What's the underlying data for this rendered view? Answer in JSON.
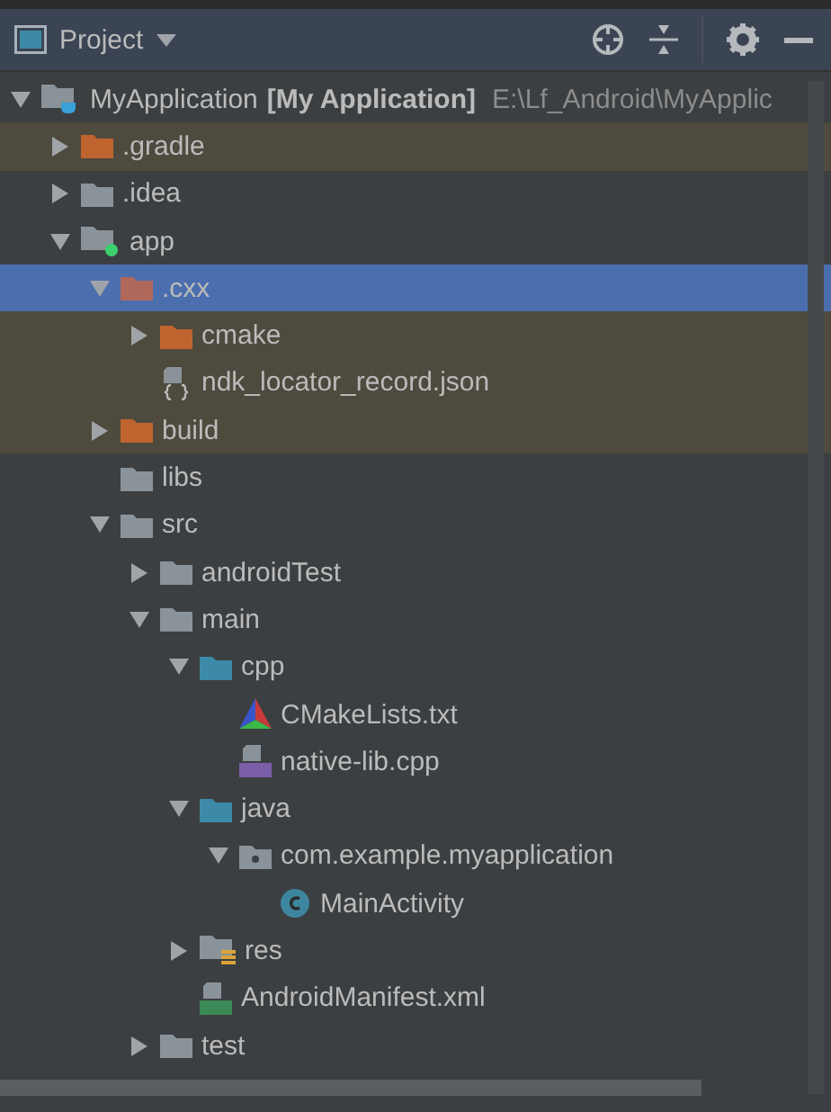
{
  "panel": {
    "title": "Project"
  },
  "tree": [
    {
      "kind": "module",
      "name": "MyApplication",
      "module": "[My Application]",
      "path": "E:\\Lf_Android\\MyApplic",
      "expanded": true,
      "selected": false,
      "excluded": false,
      "children": [
        {
          "kind": "folder",
          "color": "#c0642f",
          "name": ".gradle",
          "expanded": false,
          "selected": false,
          "excluded": true
        },
        {
          "kind": "folder",
          "color": "#8a9399",
          "name": ".idea",
          "expanded": false,
          "selected": false,
          "excluded": false
        },
        {
          "kind": "app-module",
          "name": "app",
          "expanded": true,
          "selected": false,
          "excluded": false,
          "children": [
            {
              "kind": "folder",
              "color": "#b0685a",
              "name": ".cxx",
              "expanded": true,
              "selected": true,
              "excluded": true,
              "children": [
                {
                  "kind": "folder",
                  "color": "#c0642f",
                  "name": "cmake",
                  "expanded": false,
                  "selected": false,
                  "excluded": true
                },
                {
                  "kind": "json-file",
                  "name": "ndk_locator_record.json",
                  "selected": false,
                  "excluded": true
                }
              ]
            },
            {
              "kind": "folder",
              "color": "#c0642f",
              "name": "build",
              "expanded": false,
              "selected": false,
              "excluded": true
            },
            {
              "kind": "folder",
              "color": "#8a9399",
              "name": "libs",
              "selected": false,
              "excluded": false
            },
            {
              "kind": "folder",
              "color": "#8a9399",
              "name": "src",
              "expanded": true,
              "selected": false,
              "excluded": false,
              "children": [
                {
                  "kind": "folder",
                  "color": "#8a9399",
                  "name": "androidTest",
                  "expanded": false,
                  "selected": false,
                  "excluded": false
                },
                {
                  "kind": "folder",
                  "color": "#8a9399",
                  "name": "main",
                  "expanded": true,
                  "selected": false,
                  "excluded": false,
                  "children": [
                    {
                      "kind": "folder",
                      "color": "#3d8aa8",
                      "name": "cpp",
                      "expanded": true,
                      "selected": false,
                      "excluded": false,
                      "children": [
                        {
                          "kind": "cmake-file",
                          "name": "CMakeLists.txt",
                          "selected": false,
                          "excluded": false
                        },
                        {
                          "kind": "cpp-file",
                          "name": "native-lib.cpp",
                          "selected": false,
                          "excluded": false
                        }
                      ]
                    },
                    {
                      "kind": "folder",
                      "color": "#3d8aa8",
                      "name": "java",
                      "expanded": true,
                      "selected": false,
                      "excluded": false,
                      "children": [
                        {
                          "kind": "package",
                          "name": "com.example.myapplication",
                          "expanded": true,
                          "selected": false,
                          "excluded": false,
                          "children": [
                            {
                              "kind": "class",
                              "name": "MainActivity",
                              "selected": false,
                              "excluded": false
                            }
                          ]
                        }
                      ]
                    },
                    {
                      "kind": "res-folder",
                      "name": "res",
                      "expanded": false,
                      "selected": false,
                      "excluded": false
                    },
                    {
                      "kind": "manifest",
                      "name": "AndroidManifest.xml",
                      "selected": false,
                      "excluded": false
                    }
                  ]
                },
                {
                  "kind": "folder",
                  "color": "#8a9399",
                  "name": "test",
                  "expanded": false,
                  "selected": false,
                  "excluded": false
                }
              ]
            }
          ]
        }
      ]
    }
  ]
}
